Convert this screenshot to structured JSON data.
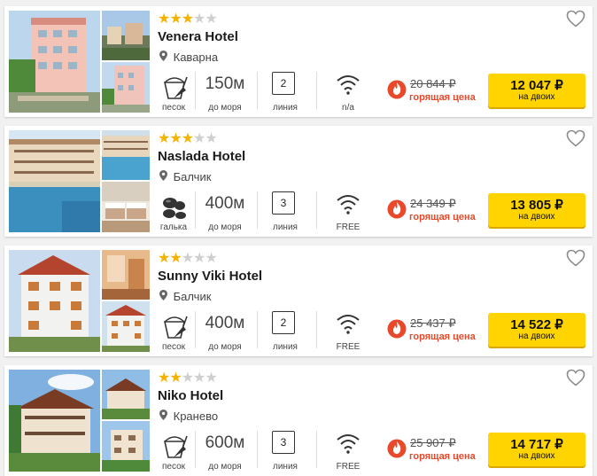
{
  "hotels": [
    {
      "stars": 3,
      "max_stars": 5,
      "name": "Venera Hotel",
      "location": "Каварна",
      "beach_type": "песок",
      "beach_icon": "bucket-icon",
      "distance": "150м",
      "distance_label": "до моря",
      "line": "2",
      "line_label": "линия",
      "wifi": "n/a",
      "old_price": "20 844 ₽",
      "hot_label": "горящая цена",
      "price": "12 047 ₽",
      "price_sub": "на двоих"
    },
    {
      "stars": 3,
      "max_stars": 5,
      "name": "Naslada Hotel",
      "location": "Балчик",
      "beach_type": "галька",
      "beach_icon": "pebbles-icon",
      "distance": "400м",
      "distance_label": "до моря",
      "line": "3",
      "line_label": "линия",
      "wifi": "FREE",
      "old_price": "24 349 ₽",
      "hot_label": "горящая цена",
      "price": "13 805 ₽",
      "price_sub": "на двоих"
    },
    {
      "stars": 2,
      "max_stars": 5,
      "name": "Sunny Viki Hotel",
      "location": "Балчик",
      "beach_type": "песок",
      "beach_icon": "bucket-icon",
      "distance": "400м",
      "distance_label": "до моря",
      "line": "2",
      "line_label": "линия",
      "wifi": "FREE",
      "old_price": "25 437 ₽",
      "hot_label": "горящая цена",
      "price": "14 522 ₽",
      "price_sub": "на двоих"
    },
    {
      "stars": 2,
      "max_stars": 5,
      "name": "Niko Hotel",
      "location": "Кранево",
      "beach_type": "песок",
      "beach_icon": "bucket-icon",
      "distance": "600м",
      "distance_label": "до моря",
      "line": "3",
      "line_label": "линия",
      "wifi": "FREE",
      "old_price": "25 907 ₽",
      "hot_label": "горящая цена",
      "price": "14 717 ₽",
      "price_sub": "на двоих"
    }
  ],
  "colors": {
    "star_active": "#f5b301",
    "star_inactive": "#cfcfcf",
    "hot_red": "#e8492a",
    "price_button": "#ffd400"
  }
}
